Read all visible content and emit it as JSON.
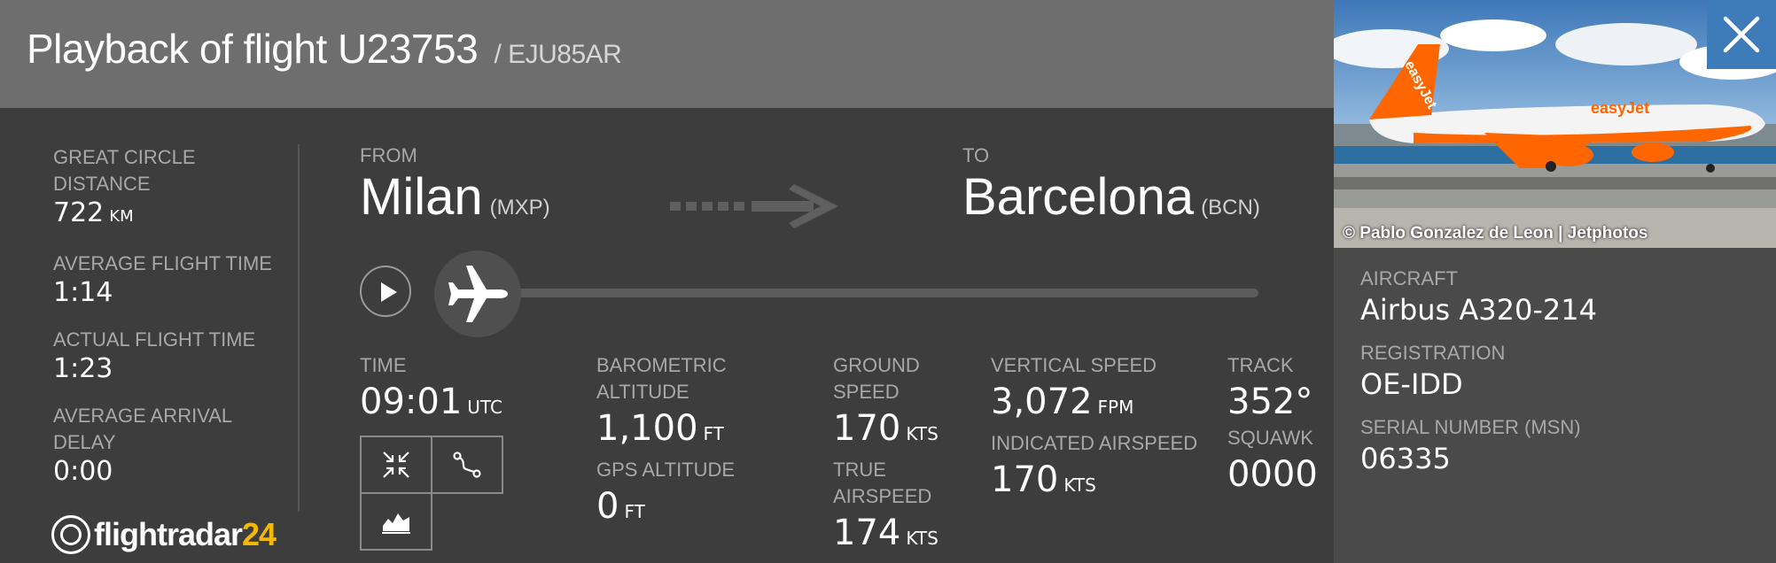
{
  "header": {
    "title": "Playback of flight U23753",
    "callsign": "/ EJU85AR"
  },
  "stats": {
    "great_circle_label": "GREAT CIRCLE DISTANCE",
    "great_circle_value": "722",
    "great_circle_unit": "KM",
    "avg_flight_label": "AVERAGE FLIGHT TIME",
    "avg_flight_value": "1:14",
    "actual_flight_label": "ACTUAL FLIGHT TIME",
    "actual_flight_value": "1:23",
    "avg_delay_label": "AVERAGE ARRIVAL DELAY",
    "avg_delay_value": "0:00"
  },
  "logo": {
    "text": "flightradar",
    "num": "24"
  },
  "route": {
    "from_label": "FROM",
    "from_city": "Milan",
    "from_code": "(MXP)",
    "to_label": "TO",
    "to_city": "Barcelona",
    "to_code": "(BCN)"
  },
  "playback": {
    "progress": 0.0
  },
  "metrics": {
    "time_label": "TIME",
    "time_value": "09:01",
    "time_unit": "UTC",
    "baro_label": "BAROMETRIC ALTITUDE",
    "baro_value": "1,100",
    "baro_unit": "FT",
    "gps_label": "GPS ALTITUDE",
    "gps_value": "0",
    "gps_unit": "FT",
    "ground_label": "GROUND SPEED",
    "ground_value": "170",
    "ground_unit": "KTS",
    "true_label": "TRUE AIRSPEED",
    "true_value": "174",
    "true_unit": "KTS",
    "vs_label": "VERTICAL SPEED",
    "vs_value": "3,072",
    "vs_unit": "FPM",
    "ias_label": "INDICATED AIRSPEED",
    "ias_value": "170",
    "ias_unit": "KTS",
    "track_label": "TRACK",
    "track_value": "352°",
    "squawk_label": "SQUAWK",
    "squawk_value": "0000"
  },
  "controls": {
    "icons": [
      "collapse-icon",
      "route-icon",
      "altitude-graph-icon"
    ]
  },
  "photo": {
    "credit": "© Pablo Gonzalez de Leon | Jetphotos"
  },
  "aircraft": {
    "aircraft_label": "AIRCRAFT",
    "aircraft_value": "Airbus A320-214",
    "registration_label": "REGISTRATION",
    "registration_value": "OE-IDD",
    "msn_label": "SERIAL NUMBER (MSN)",
    "msn_value": "06335"
  },
  "colors": {
    "header_bg": "#6e6e6e",
    "panel_bg": "#3d3d3d",
    "close_bg": "#3e7cb9",
    "logo_accent": "#f5b800"
  }
}
